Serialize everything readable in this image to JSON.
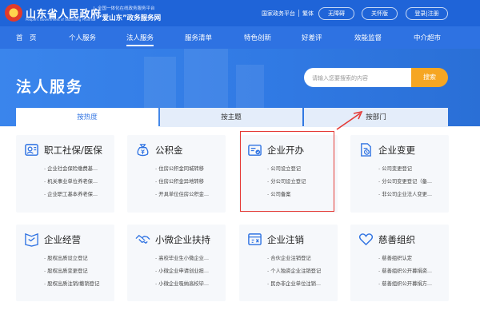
{
  "header": {
    "brand_cn": "山东省人民政府",
    "brand_en": "People's Government of Shandong Province",
    "slogan_top": "全国一体化在线政务服务平台",
    "slogan_main": "“爱山东”政务服务网",
    "links": [
      "国家政务平台",
      "繁体"
    ],
    "buttons": [
      "无障碍",
      "关怀版",
      "登录|注册"
    ]
  },
  "nav": {
    "items": [
      "首　页",
      "个人服务",
      "法人服务",
      "服务清单",
      "特色创新",
      "好差评",
      "效能监督",
      "中介超市"
    ],
    "active": "法人服务"
  },
  "hero": {
    "title": "法人服务",
    "search_placeholder": "请输入您要搜索的内容",
    "search_button": "搜索"
  },
  "tabs": [
    "按热度",
    "按主题",
    "按部门"
  ],
  "cards": [
    {
      "title": "职工社保/医保",
      "icon": "social-insurance-icon",
      "items": [
        "企业社会保险缴费基...",
        "机关事业单位养老保...",
        "企业职工基本养老保..."
      ]
    },
    {
      "title": "公积金",
      "icon": "provident-fund-icon",
      "items": [
        "住房公积金同城转移",
        "住房公积金异地转移",
        "开具单位住房公积金..."
      ]
    },
    {
      "title": "企业开办",
      "icon": "enterprise-opening-icon",
      "items": [
        "公司设立登记",
        "分公司设立登记",
        "公司备案"
      ]
    },
    {
      "title": "企业变更",
      "icon": "enterprise-change-icon",
      "items": [
        "公司变更登记",
        "分公司变更登记（备...",
        "非公司企业法人变更..."
      ]
    },
    {
      "title": "企业经营",
      "icon": "enterprise-operation-icon",
      "items": [
        "股权出质设立登记",
        "股权出质变更登记",
        "股权出质注销/撤销登记"
      ]
    },
    {
      "title": "小微企业扶持",
      "icon": "handshake-icon",
      "items": [
        "高校毕业生小微企业...",
        "小微企业申请创业担...",
        "小微企业吸纳高校毕..."
      ]
    },
    {
      "title": "企业注销",
      "icon": "enterprise-cancel-icon",
      "items": [
        "合伙企业注销登记",
        "个人独资企业注销登记",
        "民办非企业单位注销..."
      ]
    },
    {
      "title": "慈善组织",
      "icon": "heart-icon",
      "items": [
        "慈善组织认定",
        "慈善组织公开募捐资...",
        "慈善组织公开募捐方..."
      ]
    }
  ],
  "colors": {
    "primary": "#1f64d8",
    "nav": "#2e72e2",
    "accent": "#f6a623",
    "highlight": "#e53935"
  }
}
